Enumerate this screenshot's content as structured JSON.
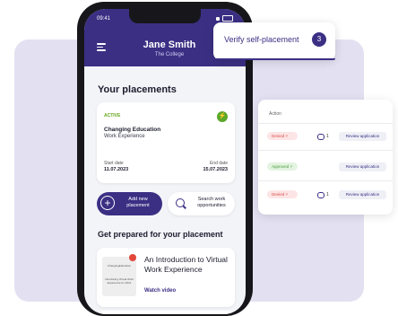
{
  "colors": {
    "primary": "#3b2f84",
    "backdrop": "#e3e1f1",
    "active": "#64a51c",
    "denied": "#d94848",
    "approved": "#4a9a3a"
  },
  "phone": {
    "status_time": "09:41",
    "user": {
      "name": "Jane Smith",
      "subtitle": "The College"
    },
    "placements_title": "Your placements",
    "placement": {
      "status": "ACTIVE",
      "status_icon": "lightning-icon",
      "title": "Changing Education",
      "subtitle": "Work Experience",
      "start_label": "Start date",
      "start_value": "11.07.2023",
      "end_label": "End date",
      "end_value": "15.07.2023"
    },
    "add_button": "Add new placement",
    "search_button": "Search work opportunities",
    "prepare_title": "Get prepared for your placement",
    "video": {
      "title": "An Introduction to Virtual Work Experience",
      "link": "Watch video",
      "thumb_logo": "ChangingEducation",
      "thumb_caption": "Introducing Virtual Work Experience for 2021"
    }
  },
  "verify_popup": {
    "label": "Verify self-placement",
    "count": "3"
  },
  "applications": {
    "header": "Action",
    "rows": [
      {
        "status": "Denied",
        "status_type": "denied",
        "comments": "1",
        "action": "Review application"
      },
      {
        "status": "Approved",
        "status_type": "approved",
        "comments": "",
        "action": "Review application"
      },
      {
        "status": "Denied",
        "status_type": "denied",
        "comments": "1",
        "action": "Review application"
      }
    ]
  }
}
